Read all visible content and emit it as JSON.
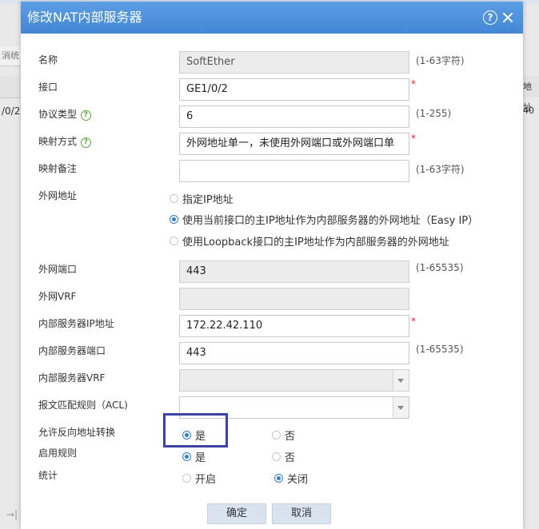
{
  "background": {
    "left_fragment_row": "消统",
    "left_cell": "/0/2",
    "right_head": "地址",
    "right_cell": "40",
    "bottom_glyph": "→|"
  },
  "dialog": {
    "title": "修改NAT内部服务器",
    "help_glyph": "?",
    "fields": {
      "name": {
        "label": "名称",
        "value": "SoftEther",
        "hint": "(1-63字符)"
      },
      "interface": {
        "label": "接口",
        "value": "GE1/0/2",
        "required": "*"
      },
      "protocol": {
        "label": "协议类型",
        "value": "6",
        "hint": "(1-255)"
      },
      "mapping": {
        "label": "映射方式",
        "value": "外网地址单一，未使用外网端口或外网端口单",
        "required": "*"
      },
      "mapping_note": {
        "label": "映射备注",
        "value": "",
        "hint": "(1-63字符)"
      },
      "public_address": {
        "label": "外网地址",
        "options": [
          "指定IP地址",
          "使用当前接口的主IP地址作为内部服务器的外网地址（Easy IP）",
          "使用Loopback接口的主IP地址作为内部服务器的外网地址"
        ],
        "selected": 1
      },
      "public_port": {
        "label": "外网端口",
        "value": "443",
        "hint": "(1-65535)"
      },
      "public_vrf": {
        "label": "外网VRF",
        "value": ""
      },
      "inside_ip": {
        "label": "内部服务器IP地址",
        "value": "172.22.42.110",
        "required": "*"
      },
      "inside_port": {
        "label": "内部服务器端口",
        "value": "443",
        "hint": "(1-65535)"
      },
      "inside_vrf": {
        "label": "内部服务器VRF",
        "value": ""
      },
      "acl": {
        "label": "报文匹配规则（ACL)",
        "value": ""
      },
      "reverse_nat": {
        "label": "允许反向地址转换",
        "yes": "是",
        "no": "否",
        "selected": "yes"
      },
      "enable_rule": {
        "label": "启用规则",
        "yes": "是",
        "no": "否",
        "selected": "yes"
      },
      "stats": {
        "label": "统计",
        "on": "开启",
        "off": "关闭",
        "selected": "off"
      }
    },
    "buttons": {
      "ok": "确定",
      "cancel": "取消"
    }
  }
}
